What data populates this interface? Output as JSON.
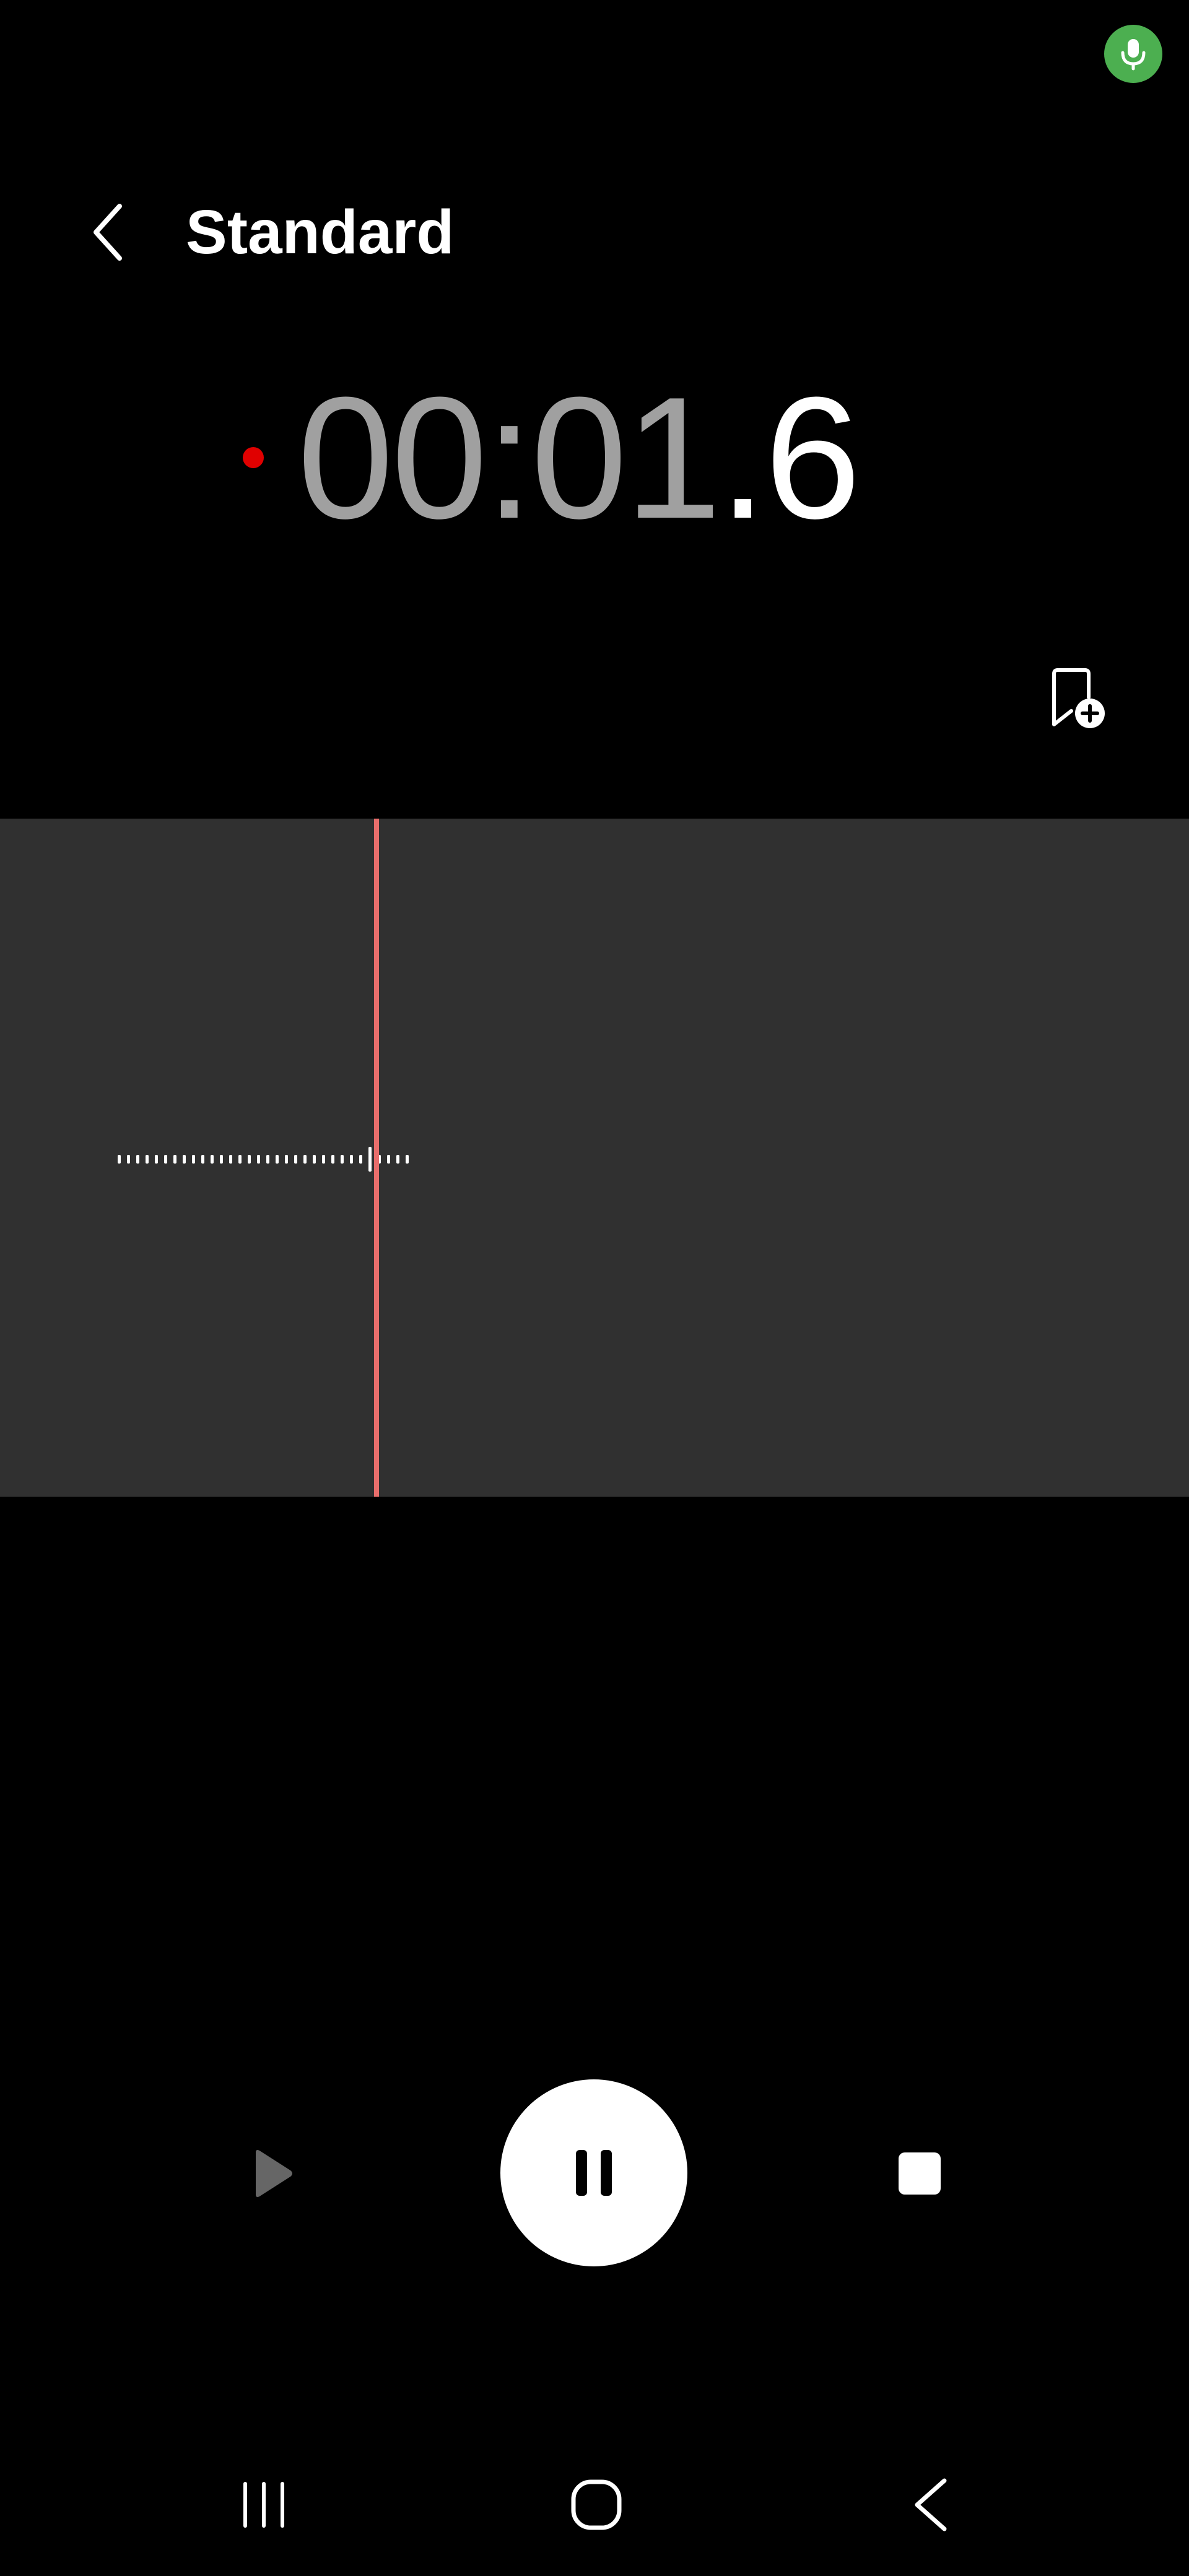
{
  "status_bar": {
    "mic_indicator_color": "#4caf50",
    "mic_icon": "microphone-icon"
  },
  "header": {
    "back_icon": "chevron-left-icon",
    "title": "Standard"
  },
  "timer": {
    "minutes": "00",
    "separator": ":",
    "seconds": "01",
    "tenths": ".6",
    "recording_dot_color": "#e00000"
  },
  "bookmark": {
    "icon": "bookmark-add-icon"
  },
  "waveform": {
    "panel_color": "#303030",
    "playhead_color": "#e86e6c"
  },
  "controls": {
    "play_icon": "play-icon",
    "pause_icon": "pause-icon",
    "stop_icon": "stop-icon"
  },
  "navigation_bar": {
    "recents_icon": "recents-icon",
    "home_icon": "home-icon",
    "back_icon": "back-icon"
  }
}
